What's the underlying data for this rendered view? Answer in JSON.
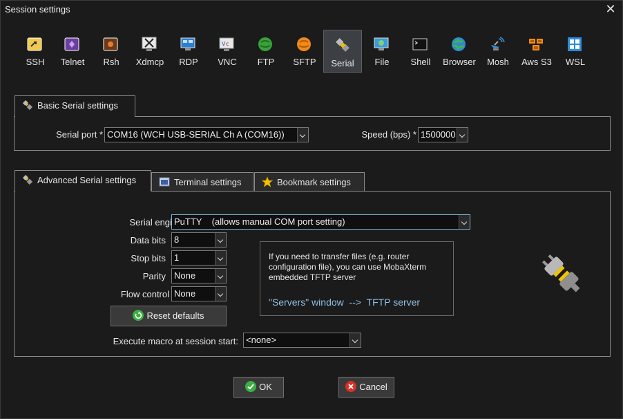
{
  "window": {
    "title": "Session settings"
  },
  "toolbar": [
    {
      "label": "SSH",
      "icon": "ssh-icon"
    },
    {
      "label": "Telnet",
      "icon": "telnet-icon"
    },
    {
      "label": "Rsh",
      "icon": "rsh-icon"
    },
    {
      "label": "Xdmcp",
      "icon": "xdmcp-icon"
    },
    {
      "label": "RDP",
      "icon": "rdp-icon"
    },
    {
      "label": "VNC",
      "icon": "vnc-icon"
    },
    {
      "label": "FTP",
      "icon": "ftp-icon"
    },
    {
      "label": "SFTP",
      "icon": "sftp-icon"
    },
    {
      "label": "Serial",
      "icon": "serial-icon",
      "active": true
    },
    {
      "label": "File",
      "icon": "file-icon"
    },
    {
      "label": "Shell",
      "icon": "shell-icon"
    },
    {
      "label": "Browser",
      "icon": "browser-icon"
    },
    {
      "label": "Mosh",
      "icon": "mosh-icon"
    },
    {
      "label": "Aws S3",
      "icon": "aws-s3-icon"
    },
    {
      "label": "WSL",
      "icon": "wsl-icon"
    }
  ],
  "basic": {
    "tab_label": "Basic Serial settings",
    "serial_port_label": "Serial port *",
    "serial_port_value": "COM16  (WCH USB-SERIAL Ch A (COM16))",
    "speed_label": "Speed (bps) *",
    "speed_value": "1500000"
  },
  "advanced": {
    "tabs": [
      "Advanced Serial settings",
      "Terminal settings",
      "Bookmark settings"
    ],
    "serial_engine_label": "Serial engine:",
    "serial_engine_value": "PuTTY    (allows manual COM port setting)",
    "data_bits_label": "Data bits",
    "data_bits_value": "8",
    "stop_bits_label": "Stop bits",
    "stop_bits_value": "1",
    "parity_label": "Parity",
    "parity_value": "None",
    "flow_label": "Flow control",
    "flow_value": "None",
    "reset_label": "Reset defaults",
    "info_text": "If you need to transfer files (e.g. router configuration file), you can use MobaXterm embedded TFTP server",
    "info_link": "\"Servers\" window  -->  TFTP server",
    "macro_label": "Execute macro at session start:",
    "macro_value": "<none>"
  },
  "footer": {
    "ok_label": "OK",
    "cancel_label": "Cancel"
  },
  "colors": {
    "accent_link": "#8fbfe6",
    "ok_green": "#3cb043",
    "cancel_red": "#d93025",
    "plug_yellow": "#f2c400"
  }
}
